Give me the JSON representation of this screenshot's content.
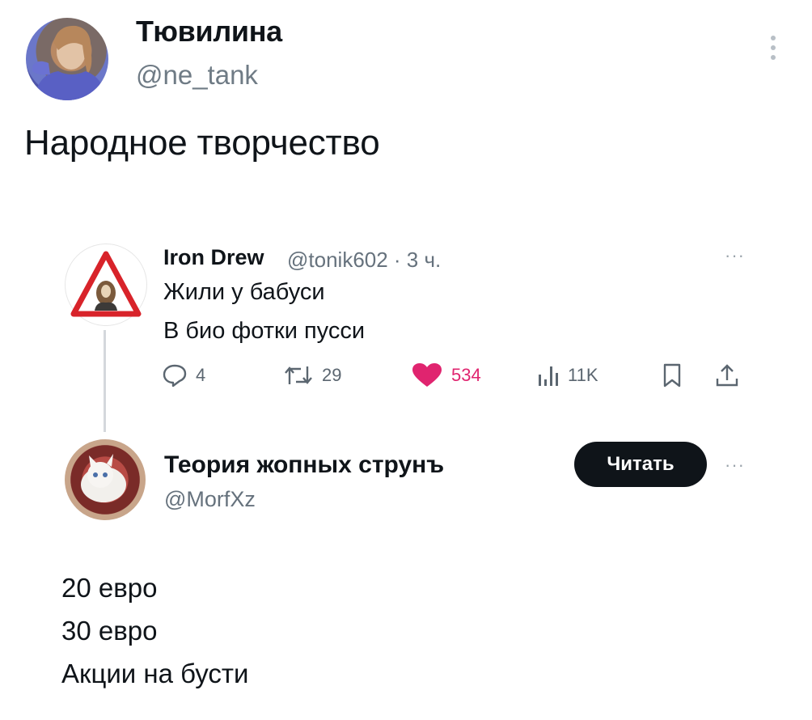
{
  "tweet": {
    "author": {
      "name": "Тювилина",
      "handle": "@ne_tank"
    },
    "text": "Народное творчество"
  },
  "quoted": {
    "author_name": "Iron Drew",
    "meta": "@tonik602 · 3 ч.",
    "lines": [
      "Жили у бабуси",
      "В био фотки пусси"
    ],
    "actions": {
      "replies": "4",
      "retweets": "29",
      "likes": "534",
      "views": "11K"
    },
    "more": "···"
  },
  "reply": {
    "author_name": "Теория жопных струнъ",
    "handle": "@MorfXz",
    "follow_label": "Читать",
    "more": "···",
    "lines": [
      "20 евро",
      "30 евро",
      "Акции на бусти"
    ]
  },
  "colors": {
    "text": "#0f1419",
    "muted": "#66727d",
    "like": "#e0246f",
    "button": "#0f1419",
    "warning_sign": "#d8232a"
  },
  "icons": [
    "reply-icon",
    "retweet-icon",
    "heart-icon",
    "views-icon",
    "bookmark-icon",
    "share-icon",
    "kebab-icon",
    "warning-sign-avatar"
  ]
}
